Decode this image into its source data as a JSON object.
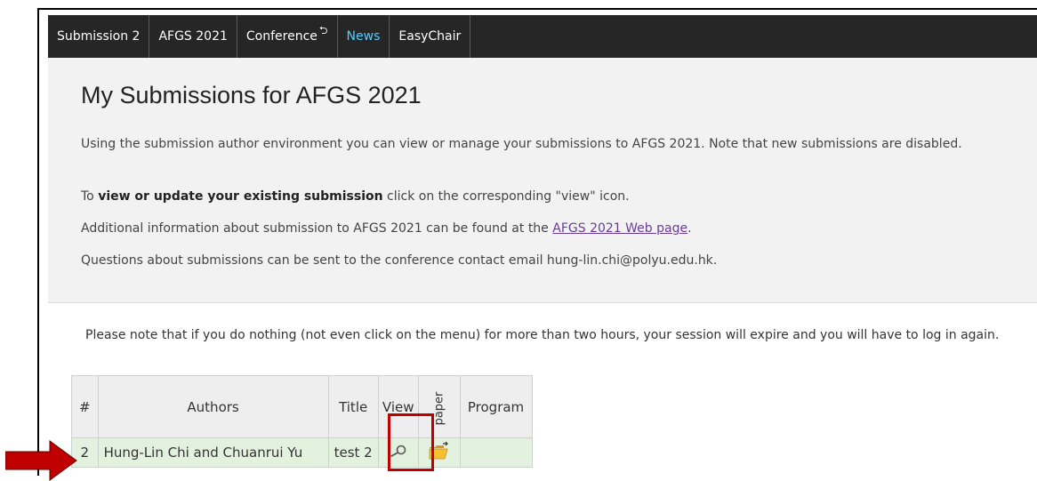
{
  "menu": {
    "items": [
      {
        "label": "Submission 2"
      },
      {
        "label": "AFGS 2021"
      },
      {
        "label": "Conference"
      },
      {
        "label": "News"
      },
      {
        "label": "EasyChair"
      }
    ]
  },
  "info": {
    "title": "My Submissions for AFGS 2021",
    "p1": "Using the submission author environment you can view or manage your submissions to AFGS 2021. Note that new submissions are disabled.",
    "p2_prefix": "To ",
    "p2_bold": "view or update your existing submission",
    "p2_suffix": " click on the corresponding \"view\" icon.",
    "p3_prefix": "Additional information about submission to AFGS 2021 can be found at the ",
    "p3_link": "AFGS 2021 Web page",
    "p3_suffix": ".",
    "p4": "Questions about submissions can be sent to the conference contact email hung-lin.chi@polyu.edu.hk."
  },
  "note": "Please note that if you do nothing (not even click on the menu) for more than two hours, your session will expire and you will have to log in again.",
  "table": {
    "headers": [
      "#",
      "Authors",
      "Title",
      "View",
      "paper",
      "Program"
    ],
    "rows": [
      {
        "num": "2",
        "authors": "Hung-Lin Chi and Chuanrui Yu",
        "title": "test 2",
        "program": ""
      }
    ]
  },
  "icons": {
    "view": "magnifier-icon",
    "paper": "folder-upload-icon",
    "back": "back-arrow-icon",
    "annotation": "red-arrow-icon"
  },
  "colors": {
    "menu_bg": "#262626",
    "news": "#4fd1ff",
    "panel_bg": "#f2f2f2",
    "row_bg": "#e3f2df",
    "highlight": "#c00000"
  }
}
